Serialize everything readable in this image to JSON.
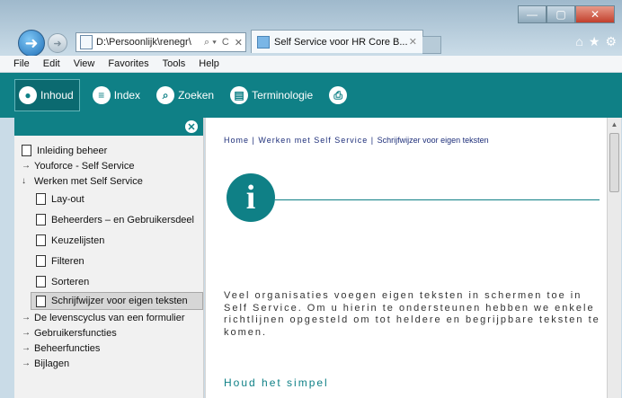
{
  "browser": {
    "address": "D:\\Persoonlijk\\renegr\\",
    "address_controls": [
      "⌕ ▾",
      "C",
      "✕"
    ],
    "tab_title": "Self Service voor HR Core B...",
    "tab_close": "✕"
  },
  "menubar": [
    "File",
    "Edit",
    "View",
    "Favorites",
    "Tools",
    "Help"
  ],
  "toolbar": {
    "items": [
      {
        "label": "Inhoud",
        "icon": "person-icon"
      },
      {
        "label": "Index",
        "icon": "list-icon"
      },
      {
        "label": "Zoeken",
        "icon": "search-icon"
      },
      {
        "label": "Terminologie",
        "icon": "book-icon"
      },
      {
        "label": "",
        "icon": "printer-icon"
      }
    ]
  },
  "tree": [
    {
      "label": "Inleiding beheer",
      "type": "doc",
      "level": 0
    },
    {
      "label": "Youforce - Self Service",
      "type": "collapsed",
      "level": 0
    },
    {
      "label": "Werken met Self Service",
      "type": "expanded",
      "level": 0
    },
    {
      "label": "Lay-out",
      "type": "doc",
      "level": 1
    },
    {
      "label": "Beheerders – en Gebruikersdeel",
      "type": "doc",
      "level": 1
    },
    {
      "label": "Keuzelijsten",
      "type": "doc",
      "level": 1
    },
    {
      "label": "Filteren",
      "type": "doc",
      "level": 1
    },
    {
      "label": "Sorteren",
      "type": "doc",
      "level": 1
    },
    {
      "label": "Schrijfwijzer voor eigen teksten",
      "type": "doc",
      "level": 1,
      "selected": true
    },
    {
      "label": "De levenscyclus van een formulier",
      "type": "collapsed",
      "level": 0
    },
    {
      "label": "Gebruikersfuncties",
      "type": "collapsed",
      "level": 0
    },
    {
      "label": "Beheerfuncties",
      "type": "collapsed",
      "level": 0
    },
    {
      "label": "Bijlagen",
      "type": "collapsed",
      "level": 0
    }
  ],
  "content": {
    "breadcrumb": {
      "home": "Home",
      "sep": " | ",
      "parent": "Werken met Self Service",
      "current": "Schrijfwijzer voor eigen teksten"
    },
    "info_symbol": "i",
    "body": "Veel organisaties voegen eigen teksten in schermen toe in Self Service. Om u hierin te ondersteunen hebben we enkele richtlijnen opgesteld om tot heldere en begrijpbare teksten te komen.",
    "subheading": "Houd het simpel"
  },
  "colors": {
    "accent": "#0f8086",
    "breadcrumb": "#1e2f7a"
  }
}
